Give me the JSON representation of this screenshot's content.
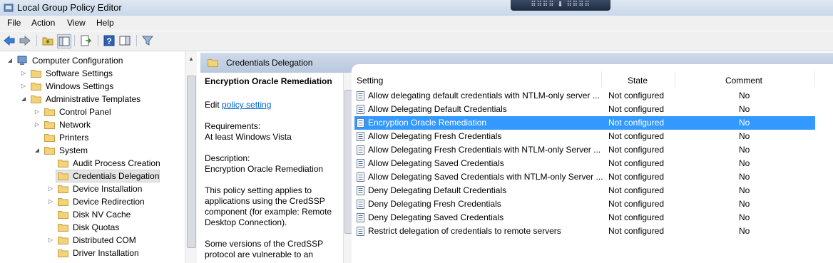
{
  "window": {
    "title": "Local Group Policy Editor",
    "remote_bar": "⠿⠿⠿⠿ ⬇ ⠿⠿⠿⠿"
  },
  "menu": [
    "File",
    "Action",
    "View",
    "Help"
  ],
  "tree": {
    "items": [
      {
        "label": "Computer Configuration",
        "expanded": true
      },
      {
        "label": "Software Settings"
      },
      {
        "label": "Windows Settings"
      },
      {
        "label": "Administrative Templates",
        "expanded": true
      },
      {
        "label": "Control Panel"
      },
      {
        "label": "Network"
      },
      {
        "label": "Printers"
      },
      {
        "label": "System",
        "expanded": true
      },
      {
        "label": "Audit Process Creation"
      },
      {
        "label": "Credentials Delegation",
        "selected": true
      },
      {
        "label": "Device Installation"
      },
      {
        "label": "Device Redirection"
      },
      {
        "label": "Disk NV Cache"
      },
      {
        "label": "Disk Quotas"
      },
      {
        "label": "Distributed COM"
      },
      {
        "label": "Driver Installation"
      }
    ]
  },
  "right_header": {
    "title": "Credentials Delegation"
  },
  "description": {
    "heading": "Encryption Oracle Remediation",
    "edit_prefix": "Edit",
    "edit_link": "policy setting",
    "requirements_label": "Requirements:",
    "requirements_value": "At least Windows Vista",
    "description_label": "Description:",
    "description_value": "Encryption Oracle Remediation",
    "para1_line1": "This policy setting applies to",
    "para1_line2": "applications using the CredSSP",
    "para1_line3": "component (for example: Remote",
    "para1_line4": "Desktop Connection).",
    "para2_line1": "Some versions of the CredSSP",
    "para2_line2": "protocol are vulnerable to an"
  },
  "table": {
    "columns": {
      "setting": "Setting",
      "state": "State",
      "comment": "Comment"
    },
    "rows": [
      {
        "setting": "Allow delegating default credentials with NTLM-only server ...",
        "state": "Not configured",
        "comment": "No"
      },
      {
        "setting": "Allow Delegating Default Credentials",
        "state": "Not configured",
        "comment": "No"
      },
      {
        "setting": "Encryption Oracle Remediation",
        "state": "Not configured",
        "comment": "No",
        "selected": true
      },
      {
        "setting": "Allow Delegating Fresh Credentials",
        "state": "Not configured",
        "comment": "No"
      },
      {
        "setting": "Allow Delegating Fresh Credentials with NTLM-only Server ...",
        "state": "Not configured",
        "comment": "No"
      },
      {
        "setting": "Allow Delegating Saved Credentials",
        "state": "Not configured",
        "comment": "No"
      },
      {
        "setting": "Allow Delegating Saved Credentials with NTLM-only Server ...",
        "state": "Not configured",
        "comment": "No"
      },
      {
        "setting": "Deny Delegating Default Credentials",
        "state": "Not configured",
        "comment": "No"
      },
      {
        "setting": "Deny Delegating Fresh Credentials",
        "state": "Not configured",
        "comment": "No"
      },
      {
        "setting": "Deny Delegating Saved Credentials",
        "state": "Not configured",
        "comment": "No"
      },
      {
        "setting": "Restrict delegation of credentials to remote servers",
        "state": "Not configured",
        "comment": "No"
      }
    ]
  },
  "colors": {
    "selection": "#3399ff",
    "link": "#0066cc",
    "header_bg": "#c4d2e6"
  }
}
